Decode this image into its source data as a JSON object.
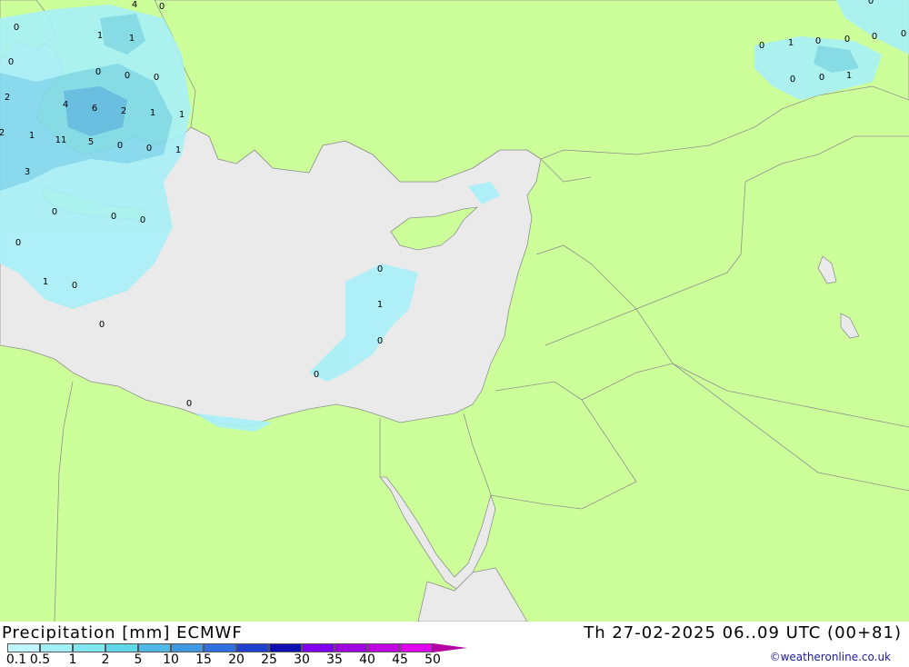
{
  "header": {
    "title_left": "Precipitation [mm] ECMWF",
    "title_right": "Th 27-02-2025 06..09 UTC (00+81)"
  },
  "legend": {
    "labels": [
      "0.1",
      "0.5",
      "1",
      "2",
      "5",
      "10",
      "15",
      "20",
      "25",
      "30",
      "35",
      "40",
      "45",
      "50"
    ],
    "colors": [
      "#bff5ff",
      "#a0f0f5",
      "#80e8f0",
      "#60d8ea",
      "#50b8e8",
      "#4098e0",
      "#3070e0",
      "#2040d0",
      "#1010b0",
      "#8000f0",
      "#a000e0",
      "#c000e0",
      "#e000f0",
      "#b300a0"
    ]
  },
  "credit": "©weatheronline.co.uk",
  "map_colors": {
    "land": "#ccff99",
    "sea": "#eaeaea",
    "border": "#909090",
    "precip_light": "#a8f0f8",
    "precip_mid": "#80d8ee",
    "precip_heavy": "#60b8e8"
  },
  "values": [
    {
      "t": "4"
    },
    {
      "t": "0"
    },
    {
      "t": "0"
    },
    {
      "t": "1"
    },
    {
      "t": "1"
    },
    {
      "t": "0"
    },
    {
      "t": "0"
    },
    {
      "t": "0"
    },
    {
      "t": "0"
    },
    {
      "t": "2"
    },
    {
      "t": "4"
    },
    {
      "t": "6"
    },
    {
      "t": "2"
    },
    {
      "t": "1"
    },
    {
      "t": "1"
    },
    {
      "t": "2"
    },
    {
      "t": "1"
    },
    {
      "t": "11"
    },
    {
      "t": "5"
    },
    {
      "t": "0"
    },
    {
      "t": "0"
    },
    {
      "t": "1"
    },
    {
      "t": "3"
    },
    {
      "t": "0"
    },
    {
      "t": "0"
    },
    {
      "t": "0"
    },
    {
      "t": "0"
    },
    {
      "t": "1"
    },
    {
      "t": "0"
    },
    {
      "t": "0"
    },
    {
      "t": "0"
    },
    {
      "t": "1"
    },
    {
      "t": "0"
    },
    {
      "t": "0"
    },
    {
      "t": "0"
    },
    {
      "t": "0"
    },
    {
      "t": "1"
    },
    {
      "t": "0"
    },
    {
      "t": "0"
    },
    {
      "t": "0"
    },
    {
      "t": "0"
    },
    {
      "t": "0"
    },
    {
      "t": "0"
    },
    {
      "t": "0"
    },
    {
      "t": "1"
    }
  ]
}
